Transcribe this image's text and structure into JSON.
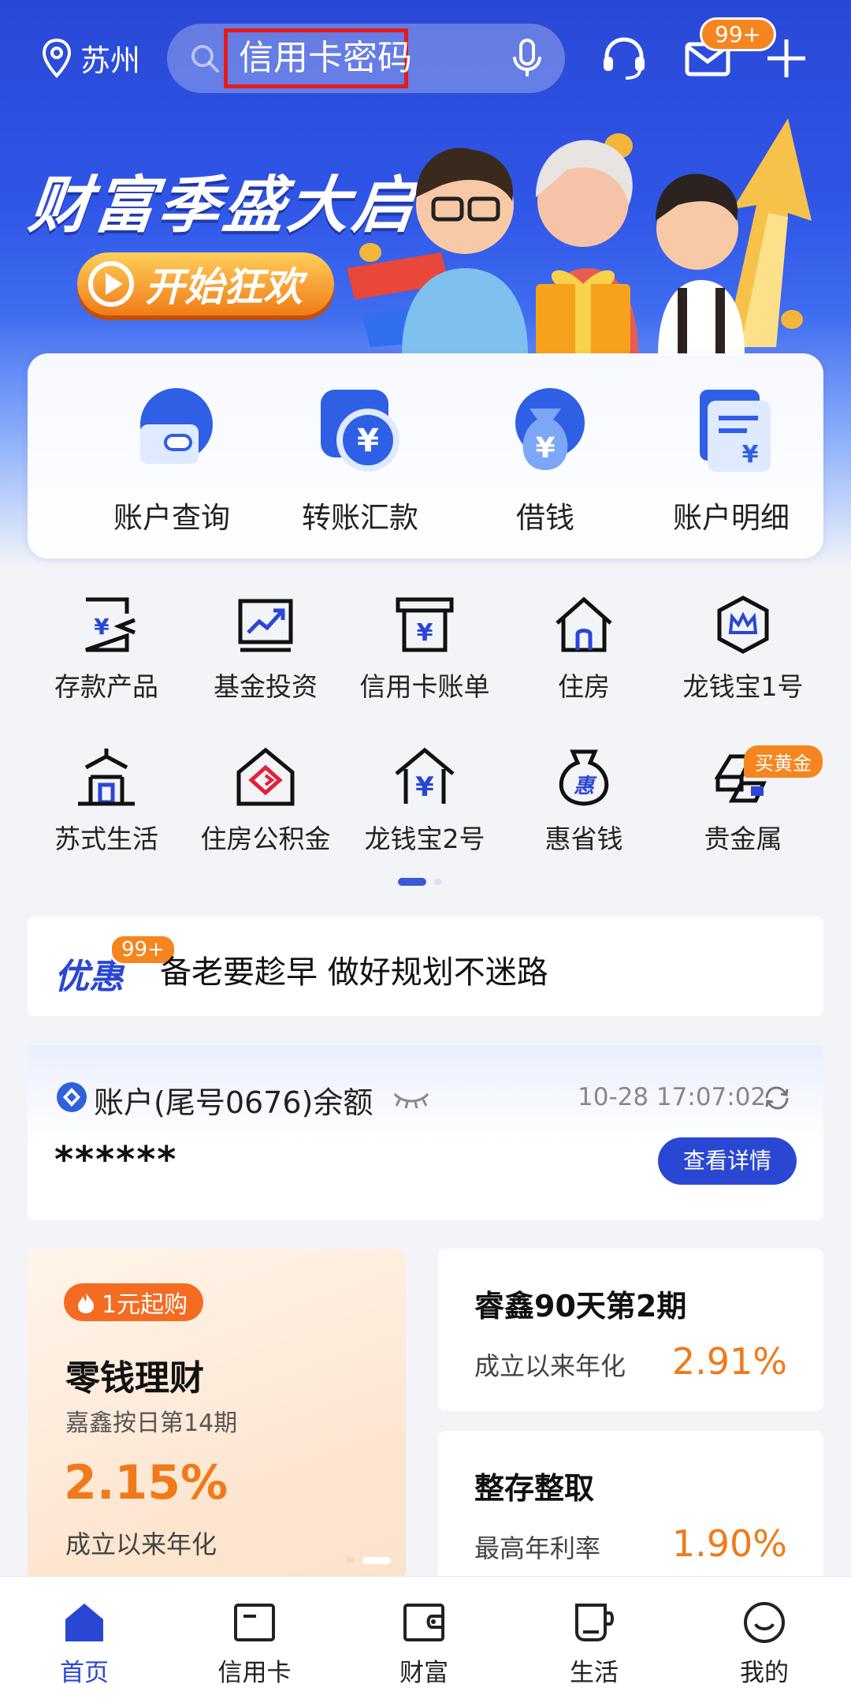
{
  "header": {
    "location": "苏州",
    "search_text": "信用卡密码",
    "mail_badge": "99+"
  },
  "banner": {
    "title": "财富季盛大启幕",
    "button": "开始狂欢"
  },
  "quick_actions": [
    {
      "label": "账户查询",
      "icon": "wallet-icon"
    },
    {
      "label": "转账汇款",
      "icon": "transfer-yuan-icon"
    },
    {
      "label": "借钱",
      "icon": "money-bag-icon"
    },
    {
      "label": "账户明细",
      "icon": "statement-icon"
    }
  ],
  "grid": [
    {
      "label": "存款产品",
      "icon": "deposit-icon"
    },
    {
      "label": "基金投资",
      "icon": "fund-chart-icon"
    },
    {
      "label": "信用卡账单",
      "icon": "card-bill-icon"
    },
    {
      "label": "住房",
      "icon": "house-icon"
    },
    {
      "label": "龙钱宝1号",
      "icon": "crown-hexagon-icon"
    },
    {
      "label": "苏式生活",
      "icon": "pavilion-icon"
    },
    {
      "label": "住房公积金",
      "icon": "housing-fund-icon"
    },
    {
      "label": "龙钱宝2号",
      "icon": "yuan-house-icon"
    },
    {
      "label": "惠省钱",
      "icon": "savings-bag-icon"
    },
    {
      "label": "贵金属",
      "icon": "gold-bars-icon"
    }
  ],
  "gold_tag": "买黄金",
  "promo": {
    "tag": "优惠",
    "badge": "99+",
    "text": "备老要趁早 做好规划不迷路"
  },
  "account": {
    "title": "账户(尾号0676)余额",
    "time": "10-28 17:07:02",
    "masked_balance": "******",
    "detail_button": "查看详情"
  },
  "products": {
    "featured": {
      "tag": "1元起购",
      "name": "零钱理财",
      "sub": "嘉鑫按日第14期",
      "rate": "2.15%",
      "note": "成立以来年化"
    },
    "items": [
      {
        "name": "睿鑫90天第2期",
        "label": "成立以来年化",
        "rate": "2.91%"
      },
      {
        "name": "整存整取",
        "label": "最高年利率",
        "rate": "1.90%"
      }
    ]
  },
  "tabbar": [
    {
      "label": "首页",
      "active": true
    },
    {
      "label": "信用卡",
      "active": false
    },
    {
      "label": "财富",
      "active": false
    },
    {
      "label": "生活",
      "active": false
    },
    {
      "label": "我的",
      "active": false
    }
  ],
  "colors": {
    "brand_blue": "#2a47d4",
    "accent_orange": "#f07a1a",
    "search_highlight": "#e41b1b"
  }
}
